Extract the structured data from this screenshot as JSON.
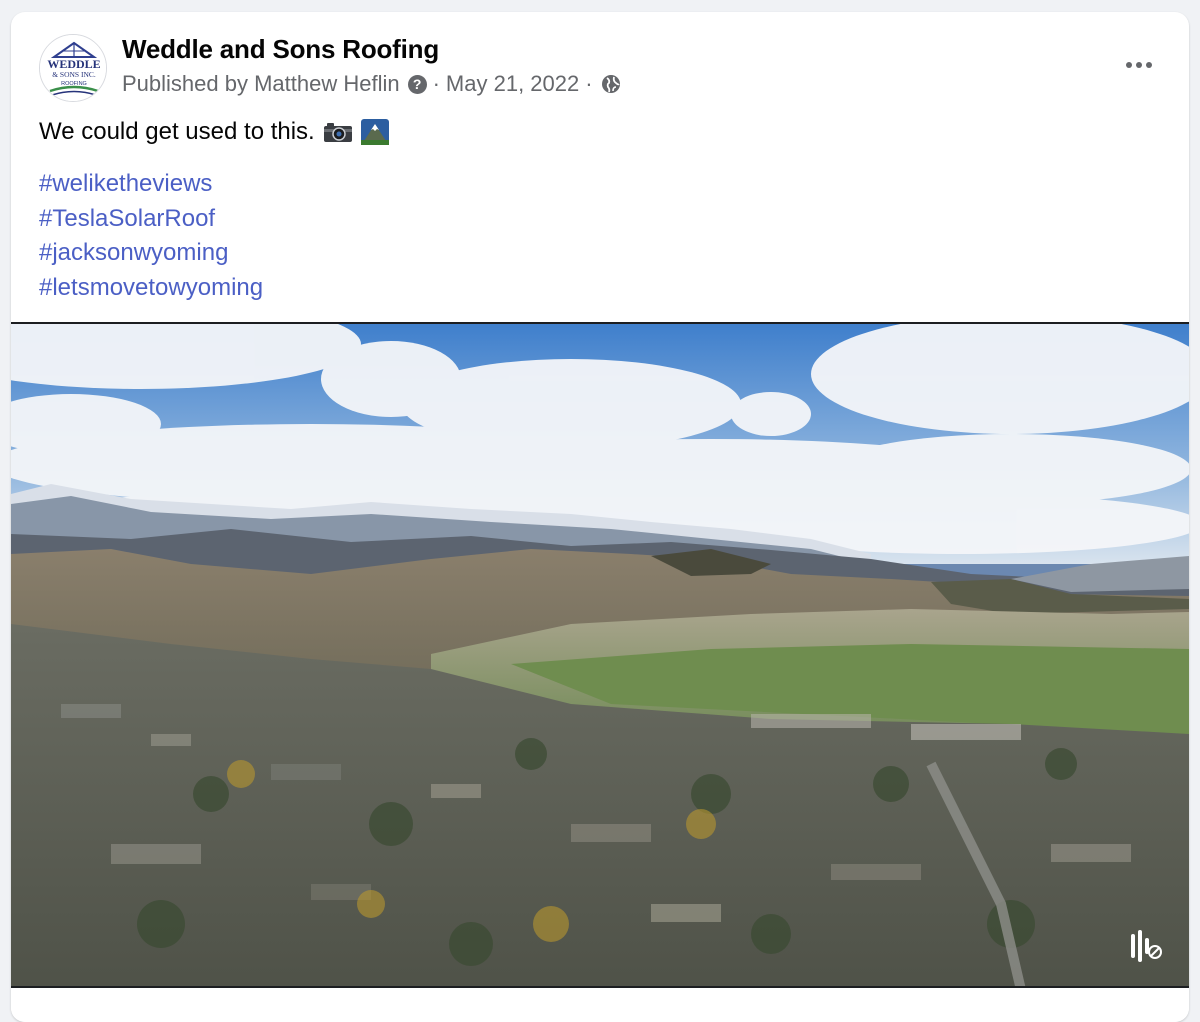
{
  "post": {
    "page_name": "Weddle and Sons Roofing",
    "logo": {
      "line1": "WEDDLE",
      "line2": "& SONS INC.",
      "line3": "ROOFING"
    },
    "meta": {
      "published_by": "Published by Matthew Heflin",
      "help_icon": "?",
      "separator": "·",
      "date": "May 21, 2022",
      "audience_icon": "globe-icon"
    },
    "text": "We could get used to this.",
    "emojis": [
      "camera-emoji",
      "mountain-emoji"
    ],
    "hashtags": [
      "#weliketheviews",
      "#TeslaSolarRoof",
      "#jacksonwyoming",
      "#letsmovetowyoming"
    ],
    "video": {
      "description_icon": "volume-muted-icon"
    }
  },
  "colors": {
    "link": "#4b5fc5",
    "secondary_text": "#65676b",
    "primary_text": "#050505",
    "page_bg": "#f0f2f5"
  }
}
